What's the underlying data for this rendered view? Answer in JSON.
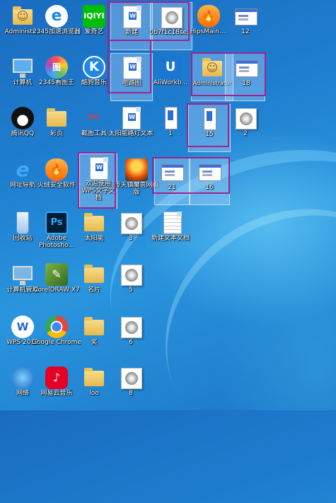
{
  "desktop": {
    "icons": [
      {
        "label": "Administr...",
        "kind": "user",
        "selected": false
      },
      {
        "label": "2345加速浏览器",
        "kind": "browser-e",
        "selected": false
      },
      {
        "label": "爱奇艺",
        "kind": "iqiyi",
        "selected": false
      },
      {
        "label": "新建",
        "kind": "wps-doc",
        "selected": true
      },
      {
        "label": "0b7f1c18se...",
        "kind": "photo",
        "selected": true
      },
      {
        "label": "HipsMain....",
        "kind": "shield",
        "selected": false
      },
      {
        "label": "12",
        "kind": "screenshot",
        "selected": false
      },
      {
        "label": "计算机",
        "kind": "computer",
        "selected": false
      },
      {
        "label": "2345看图王",
        "kind": "viewer",
        "selected": false
      },
      {
        "label": "酷狗音乐",
        "kind": "kugou",
        "selected": false
      },
      {
        "label": "电路图",
        "kind": "wps-doc",
        "selected": true
      },
      {
        "label": "AliWorkb...",
        "kind": "aliwork",
        "selected": false
      },
      {
        "label": "Administrator",
        "kind": "user-folder",
        "selected": true
      },
      {
        "label": "18",
        "kind": "screenshot",
        "selected": true
      },
      {
        "label": "腾讯QQ",
        "kind": "qq",
        "selected": false
      },
      {
        "label": "彩页",
        "kind": "folder",
        "selected": false
      },
      {
        "label": "截图工具",
        "kind": "snip",
        "selected": false
      },
      {
        "label": "太阳能路灯文本",
        "kind": "wps-doc",
        "selected": false
      },
      {
        "label": "1",
        "kind": "tall",
        "selected": false
      },
      {
        "label": "15",
        "kind": "tall",
        "selected": true
      },
      {
        "label": "2",
        "kind": "photo",
        "selected": false
      },
      {
        "label": "网址导航",
        "kind": "ie",
        "selected": false
      },
      {
        "label": "火绒安全软件",
        "kind": "shield",
        "selected": false
      },
      {
        "label": "欢迎使用WPS文字文档",
        "kind": "wps-doc",
        "selected": true
      },
      {
        "label": "传天镇魔兽网页版",
        "kind": "game",
        "selected": false
      },
      {
        "label": "21",
        "kind": "screenshot",
        "selected": true
      },
      {
        "label": "16",
        "kind": "screenshot",
        "selected": true
      },
      {
        "label": "回收站",
        "kind": "recycle",
        "selected": false
      },
      {
        "label": "Adobe Photosho...",
        "kind": "ps",
        "selected": false
      },
      {
        "label": "太阳能",
        "kind": "folder",
        "selected": false
      },
      {
        "label": "3",
        "kind": "photo",
        "selected": false
      },
      {
        "label": "新建文本文档",
        "kind": "txt",
        "selected": false
      },
      {
        "label": "计算机管理",
        "kind": "compmgmt",
        "selected": false
      },
      {
        "label": "CorelDRAW X7",
        "kind": "corel",
        "selected": false
      },
      {
        "label": "名片",
        "kind": "folder",
        "selected": false
      },
      {
        "label": "5",
        "kind": "photo",
        "selected": false
      },
      {
        "label": "WPS 2019",
        "kind": "wps",
        "selected": false
      },
      {
        "label": "Google Chrome",
        "kind": "chrome",
        "selected": false
      },
      {
        "label": "奖",
        "kind": "folder",
        "selected": false
      },
      {
        "label": "6",
        "kind": "photo",
        "selected": false
      },
      {
        "label": "网络",
        "kind": "network",
        "selected": false
      },
      {
        "label": "网易云音乐",
        "kind": "music163",
        "selected": false
      },
      {
        "label": "loo",
        "kind": "folder",
        "selected": false
      },
      {
        "label": "8",
        "kind": "photo",
        "selected": false
      }
    ]
  },
  "colors": {
    "highlight_frame": "#a0238f",
    "desktop_blue": "#1f7fd0"
  }
}
